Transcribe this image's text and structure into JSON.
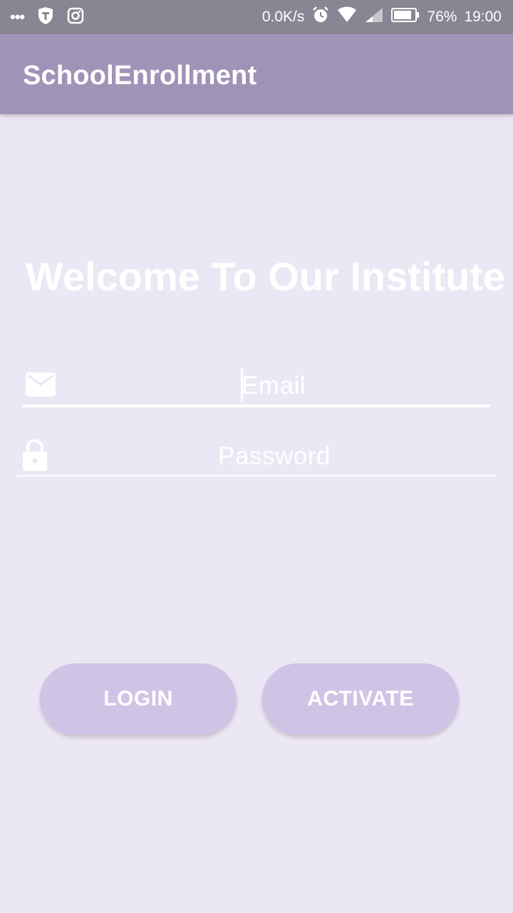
{
  "status_bar": {
    "left_icons": [
      "more-dots-icon",
      "shield-icon",
      "instagram-icon"
    ],
    "dots": "•••",
    "net_speed": "0.0K/s",
    "battery_percent": "76%",
    "time": "19:00",
    "right_icons": [
      "alarm-icon",
      "wifi-icon",
      "signal-icon",
      "battery-icon"
    ]
  },
  "app_bar": {
    "title": "SchoolEnrollment"
  },
  "main": {
    "welcome_text": "Welcome To Our Institute",
    "email_placeholder": "Email",
    "password_placeholder": "Password",
    "login_label": "LOGIN",
    "activate_label": "ACTIVATE"
  },
  "colors": {
    "background": "#ece7f4",
    "app_bar": "#9f94b7",
    "status_bar": "#8a8592",
    "button": "#d0c4e6",
    "text": "#ffffff"
  }
}
